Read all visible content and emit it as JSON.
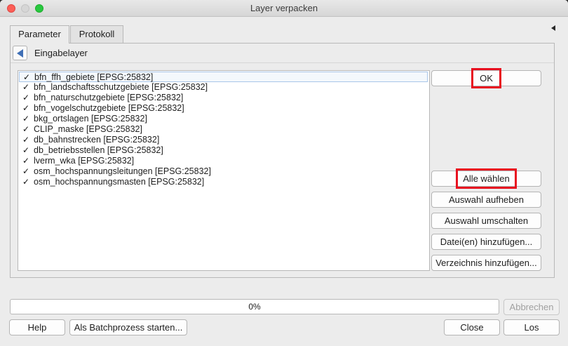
{
  "window": {
    "title": "Layer verpacken"
  },
  "tabs": [
    {
      "label": "Parameter",
      "active": true
    },
    {
      "label": "Protokoll",
      "active": false
    }
  ],
  "panel": {
    "title": "Eingabelayer"
  },
  "layers": [
    {
      "label": "bfn_ffh_gebiete [EPSG:25832]",
      "checked": true
    },
    {
      "label": "bfn_landschaftsschutzgebiete [EPSG:25832]",
      "checked": true
    },
    {
      "label": "bfn_naturschutzgebiete [EPSG:25832]",
      "checked": true
    },
    {
      "label": "bfn_vogelschutzgebiete [EPSG:25832]",
      "checked": true
    },
    {
      "label": "bkg_ortslagen [EPSG:25832]",
      "checked": true
    },
    {
      "label": "CLIP_maske [EPSG:25832]",
      "checked": true
    },
    {
      "label": "db_bahnstrecken [EPSG:25832]",
      "checked": true
    },
    {
      "label": "db_betriebsstellen [EPSG:25832]",
      "checked": true
    },
    {
      "label": "lverm_wka [EPSG:25832]",
      "checked": true
    },
    {
      "label": "osm_hochspannungsleitungen [EPSG:25832]",
      "checked": true
    },
    {
      "label": "osm_hochspannungsmasten [EPSG:25832]",
      "checked": true
    }
  ],
  "side_buttons": {
    "ok": "OK",
    "select_all": "Alle wählen",
    "clear_selection": "Auswahl aufheben",
    "toggle_selection": "Auswahl umschalten",
    "add_files": "Datei(en) hinzufügen...",
    "add_directory": "Verzeichnis hinzufügen..."
  },
  "progress": {
    "text": "0%",
    "value": 0
  },
  "footer": {
    "cancel": "Abbrechen",
    "help": "Help",
    "batch": "Als Batchprozess starten...",
    "close": "Close",
    "run": "Los"
  },
  "colors": {
    "highlight": "#e81020",
    "accent": "#3f6fb6"
  }
}
